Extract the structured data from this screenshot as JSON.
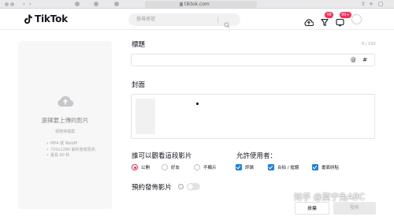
{
  "browser": {
    "url": "tiktok.com"
  },
  "header": {
    "logo_text": "TikTok",
    "search_placeholder": "搜尋帳號",
    "inbox_badge": "48",
    "messages_badge": "99+"
  },
  "upload": {
    "title": "選擇要上傳的影片",
    "subtitle": "或拖曳檔案",
    "requirements": [
      "MP4 或 WebM",
      "720x1280 解析度或更高",
      "最長 60 秒"
    ]
  },
  "form": {
    "caption_label": "標題",
    "caption_counter": "0 / 150",
    "caption_tools": "@ #",
    "cover_label": "封面",
    "privacy_label": "誰可以觀看這段影片",
    "privacy_options": [
      {
        "label": "公開",
        "selected": true
      },
      {
        "label": "好友",
        "selected": false
      },
      {
        "label": "不顯示",
        "selected": false
      }
    ],
    "allow_label": "允許使用者：",
    "allow_options": [
      {
        "label": "評論",
        "checked": true
      },
      {
        "label": "合拍 / 搶鏡",
        "checked": true
      },
      {
        "label": "畫面拼貼",
        "checked": true
      }
    ],
    "schedule_label": "預約發佈影片",
    "schedule_info": "i",
    "schedule_enabled": false
  },
  "actions": {
    "discard_label": "捨棄",
    "post_label": "發佈"
  },
  "watermark": "知乎 @莫宁兔ABC",
  "colors": {
    "brand": "#fe2c55",
    "checkbox": "#1d84de"
  }
}
